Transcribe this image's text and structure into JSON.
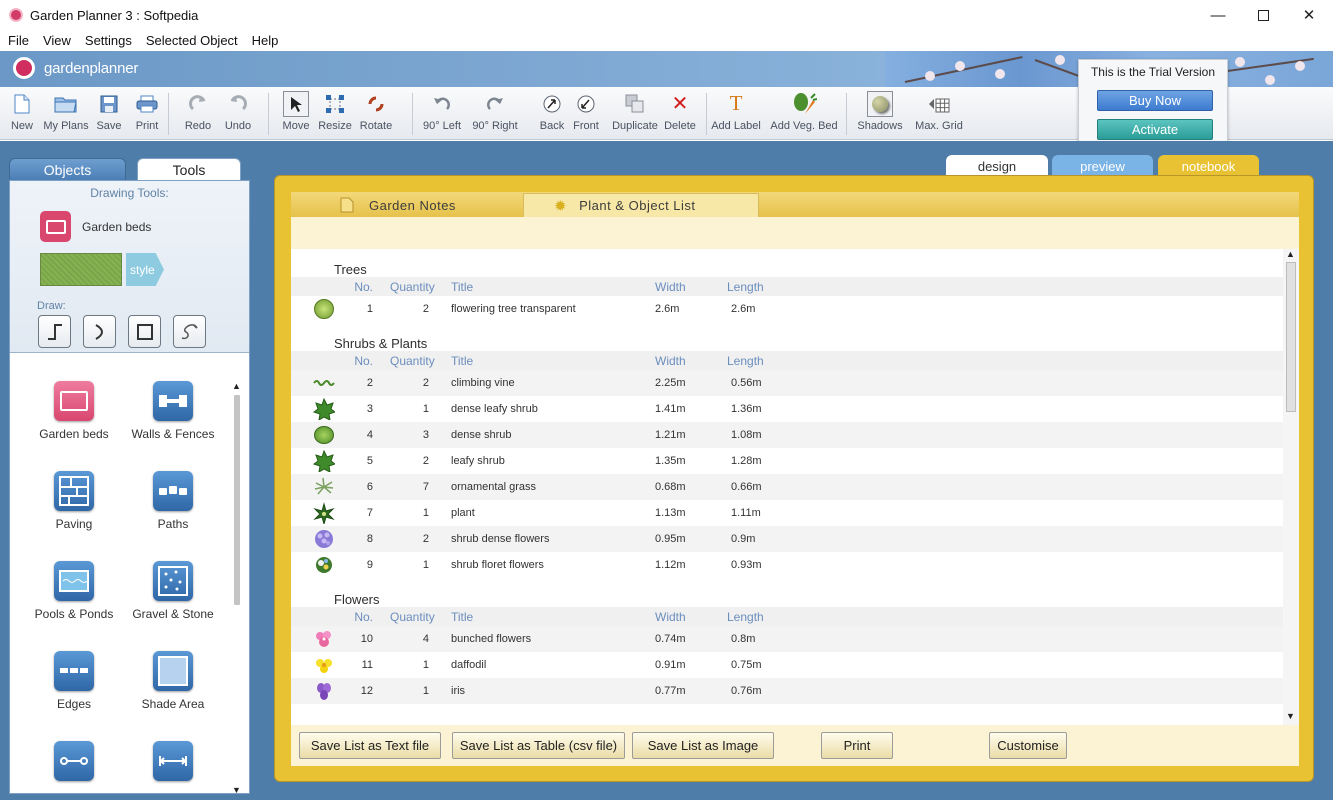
{
  "window": {
    "title": "Garden Planner 3 : Softpedia",
    "minimize_icon": "minimize-icon",
    "maximize_icon": "maximize-icon",
    "close_icon": "close-icon"
  },
  "menu": [
    "File",
    "View",
    "Settings",
    "Selected Object",
    "Help"
  ],
  "brand": {
    "logo_text": "gardenplanner",
    "accent": "#cf2e5f"
  },
  "toolbar": [
    {
      "label": "New",
      "icon": "new-icon"
    },
    {
      "label": "My Plans",
      "icon": "folder-icon"
    },
    {
      "label": "Save",
      "icon": "save-icon"
    },
    {
      "label": "Print",
      "icon": "print-icon"
    },
    {
      "label": "Redo",
      "icon": "redo-icon"
    },
    {
      "label": "Undo",
      "icon": "undo-icon"
    },
    {
      "label": "Move",
      "icon": "move-cursor-icon"
    },
    {
      "label": "Resize",
      "icon": "resize-icon"
    },
    {
      "label": "Rotate",
      "icon": "rotate-icon"
    },
    {
      "label": "90° Left",
      "icon": "rotate-left-icon"
    },
    {
      "label": "90° Right",
      "icon": "rotate-right-icon"
    },
    {
      "label": "Back",
      "icon": "send-back-icon"
    },
    {
      "label": "Front",
      "icon": "bring-front-icon"
    },
    {
      "label": "Duplicate",
      "icon": "duplicate-icon"
    },
    {
      "label": "Delete",
      "icon": "delete-icon"
    },
    {
      "label": "Add Label",
      "icon": "text-icon"
    },
    {
      "label": "Add Veg. Bed",
      "icon": "veg-bed-icon"
    },
    {
      "label": "Shadows",
      "icon": "shadows-icon"
    },
    {
      "label": "Max. Grid",
      "icon": "grid-icon"
    }
  ],
  "trial": {
    "text": "This is the Trial Version",
    "buy_label": "Buy Now",
    "activate_label": "Activate"
  },
  "left_panel": {
    "tabs": [
      "Objects",
      "Tools"
    ],
    "active_tab": "Tools",
    "drawing_tools_title": "Drawing Tools:",
    "selected_tool": "Garden beds",
    "style_label": "style",
    "draw_label": "Draw:",
    "draw_modes": [
      "straight-line-icon",
      "curve-icon",
      "rectangle-icon",
      "freehand-icon"
    ],
    "objects": [
      {
        "label": "Garden beds",
        "icon": "garden-bed-icon",
        "color": "#d9476f"
      },
      {
        "label": "Walls & Fences",
        "icon": "walls-fences-icon",
        "color": "#3877b6"
      },
      {
        "label": "Paving",
        "icon": "paving-icon",
        "color": "#3877b6"
      },
      {
        "label": "Paths",
        "icon": "paths-icon",
        "color": "#3877b6"
      },
      {
        "label": "Pools & Ponds",
        "icon": "pools-ponds-icon",
        "color": "#3877b6"
      },
      {
        "label": "Gravel & Stone",
        "icon": "gravel-stone-icon",
        "color": "#3877b6"
      },
      {
        "label": "Edges",
        "icon": "edges-icon",
        "color": "#3877b6"
      },
      {
        "label": "Shade Area",
        "icon": "shade-area-icon",
        "color": "#3877b6"
      },
      {
        "label": "",
        "icon": "connector-icon",
        "color": "#3877b6"
      },
      {
        "label": "",
        "icon": "dimension-icon",
        "color": "#3877b6"
      }
    ]
  },
  "view_tabs": [
    "design",
    "preview",
    "notebook"
  ],
  "active_view": "notebook",
  "notebook": {
    "subtabs": [
      "Garden Notes",
      "Plant & Object List"
    ],
    "active_subtab": "Plant & Object List",
    "columns": [
      "No.",
      "Quantity",
      "Title",
      "Width",
      "Length"
    ],
    "sections": [
      {
        "title": "Trees",
        "rows": [
          {
            "no": "1",
            "qty": "2",
            "title": "flowering tree transparent",
            "width": "2.6m",
            "length": "2.6m",
            "icon": "tree-icon"
          }
        ]
      },
      {
        "title": "Shrubs & Plants",
        "rows": [
          {
            "no": "2",
            "qty": "2",
            "title": "climbing vine",
            "width": "2.25m",
            "length": "0.56m",
            "icon": "vine-icon"
          },
          {
            "no": "3",
            "qty": "1",
            "title": "dense leafy shrub",
            "width": "1.41m",
            "length": "1.36m",
            "icon": "leafy-shrub-icon"
          },
          {
            "no": "4",
            "qty": "3",
            "title": "dense shrub",
            "width": "1.21m",
            "length": "1.08m",
            "icon": "dense-shrub-icon"
          },
          {
            "no": "5",
            "qty": "2",
            "title": "leafy shrub",
            "width": "1.35m",
            "length": "1.28m",
            "icon": "leafy-shrub-icon"
          },
          {
            "no": "6",
            "qty": "7",
            "title": "ornamental grass",
            "width": "0.68m",
            "length": "0.66m",
            "icon": "grass-icon"
          },
          {
            "no": "7",
            "qty": "1",
            "title": "plant",
            "width": "1.13m",
            "length": "1.11m",
            "icon": "plant-icon"
          },
          {
            "no": "8",
            "qty": "2",
            "title": "shrub dense flowers",
            "width": "0.95m",
            "length": "0.9m",
            "icon": "flower-shrub-icon"
          },
          {
            "no": "9",
            "qty": "1",
            "title": "shrub floret flowers",
            "width": "1.12m",
            "length": "0.93m",
            "icon": "floret-shrub-icon"
          }
        ]
      },
      {
        "title": "Flowers",
        "rows": [
          {
            "no": "10",
            "qty": "4",
            "title": "bunched flowers",
            "width": "0.74m",
            "length": "0.8m",
            "icon": "pink-flower-icon"
          },
          {
            "no": "11",
            "qty": "1",
            "title": "daffodil",
            "width": "0.91m",
            "length": "0.75m",
            "icon": "daffodil-icon"
          },
          {
            "no": "12",
            "qty": "1",
            "title": "iris",
            "width": "0.77m",
            "length": "0.76m",
            "icon": "iris-icon"
          }
        ]
      }
    ],
    "buttons": [
      "Save List as Text file",
      "Save List as Table (csv file)",
      "Save List as Image",
      "Print",
      "Customise"
    ]
  }
}
